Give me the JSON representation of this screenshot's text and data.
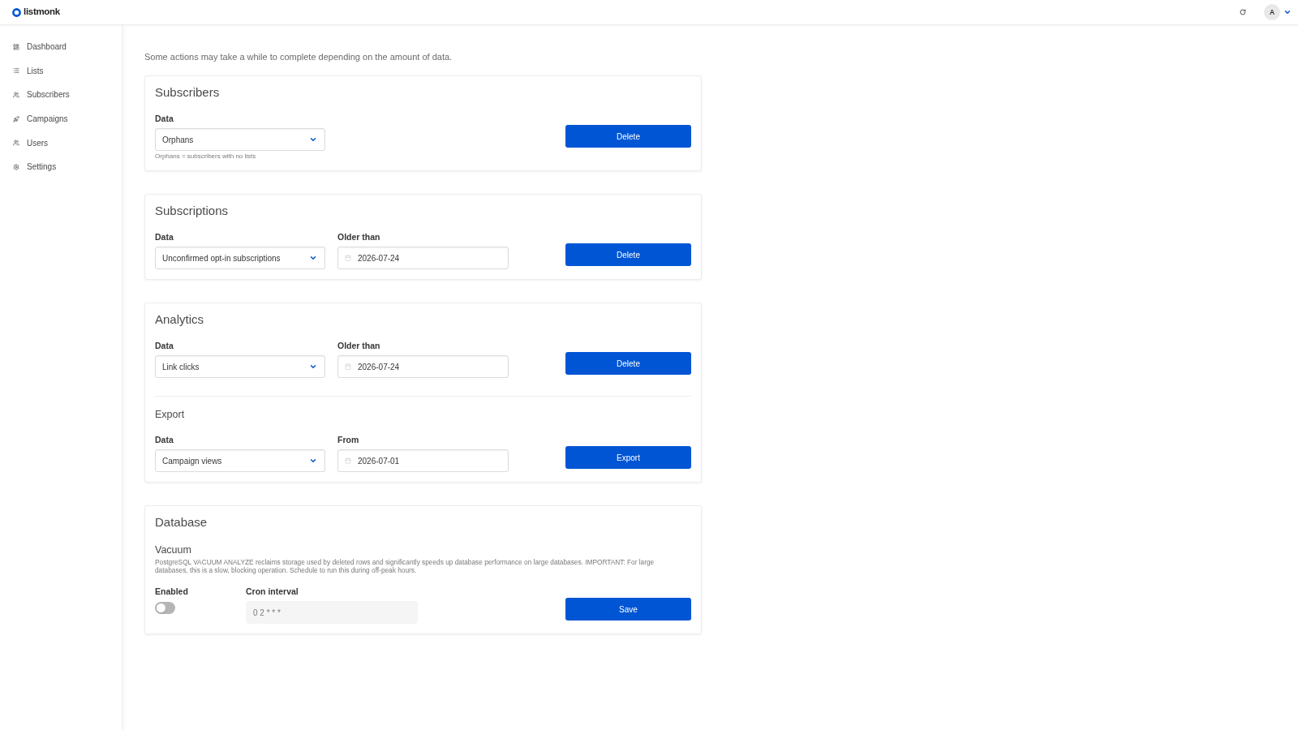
{
  "header": {
    "logo": "listmonk",
    "avatar": "A"
  },
  "sidebar": {
    "items": [
      "Dashboard",
      "Lists",
      "Subscribers",
      "Campaigns",
      "Users",
      "Settings"
    ]
  },
  "intro": "Some actions may take a while to complete depending on the amount of data.",
  "sections": [
    {
      "title": "Subscribers",
      "rows": [
        {
          "fields": [
            {
              "kind": "select",
              "label": "Data",
              "value": "Orphans",
              "hint": "Orphans = subscribers with no lists"
            }
          ],
          "button": "Delete"
        }
      ]
    },
    {
      "title": "Subscriptions",
      "rows": [
        {
          "fields": [
            {
              "kind": "select",
              "label": "Data",
              "value": "Unconfirmed opt-in subscriptions"
            },
            {
              "kind": "date",
              "label": "Older than",
              "value": "2026-07-24"
            }
          ],
          "button": "Delete"
        }
      ]
    },
    {
      "title": "Analytics",
      "rows": [
        {
          "fields": [
            {
              "kind": "select",
              "label": "Data",
              "value": "Link clicks"
            },
            {
              "kind": "date",
              "label": "Older than",
              "value": "2026-07-24"
            }
          ],
          "button": "Delete"
        },
        {
          "heading": "Export",
          "fields": [
            {
              "kind": "select",
              "label": "Data",
              "value": "Campaign views"
            },
            {
              "kind": "date",
              "label": "From",
              "value": "2026-07-01"
            }
          ],
          "button": "Export"
        }
      ]
    },
    {
      "title": "Database",
      "rows": [
        {
          "heading": "Vacuum",
          "description": "PostgreSQL VACUUM ANALYZE reclaims storage used by deleted rows and significantly speeds up database performance on large databases. IMPORTANT: For large databases, this is a slow, blocking operation. Schedule to run this during off-peak hours.",
          "fields": [
            {
              "kind": "toggle",
              "label": "Enabled",
              "on": false,
              "disabled": false
            },
            {
              "kind": "text",
              "label": "Cron interval",
              "value": "0 2 * * *",
              "disabled": true
            }
          ],
          "button": "Save"
        }
      ]
    }
  ]
}
